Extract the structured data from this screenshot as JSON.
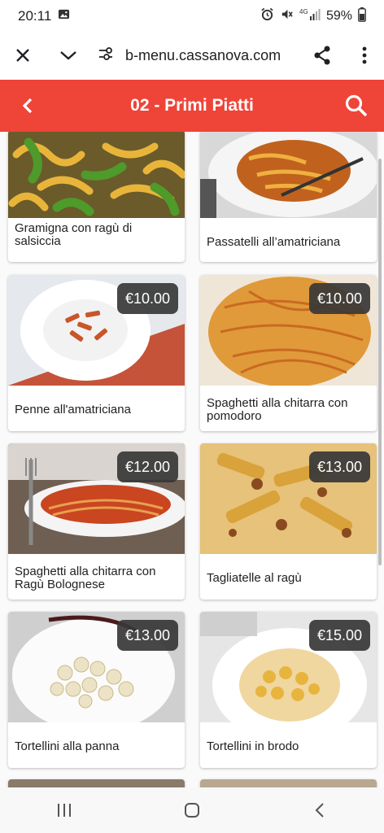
{
  "status_bar": {
    "time": "20:11",
    "battery": "59%",
    "signal_label": "4G",
    "icons": [
      "image-icon",
      "alarm-icon",
      "mute-icon",
      "signal-icon",
      "battery-icon"
    ]
  },
  "browser": {
    "url": "b-menu.cassanova.com",
    "icons": [
      "close-icon",
      "chevron-down-icon",
      "site-settings-icon",
      "share-icon",
      "more-vert-icon"
    ]
  },
  "header": {
    "title": "02 - Primi Piatti",
    "background": "#ef4438",
    "icons": [
      "back-arrow-icon",
      "search-icon"
    ]
  },
  "menu_items": [
    {
      "name": "Gramigna con ragù di salsiccia",
      "price": ""
    },
    {
      "name": "Passatelli all’amatriciana",
      "price": ""
    },
    {
      "name": "Penne all'amatriciana",
      "price": "€10.00"
    },
    {
      "name": "Spaghetti alla chitarra con pomodoro",
      "price": "€10.00"
    },
    {
      "name": "Spaghetti alla chitarra con Ragù Bolognese",
      "price": "€12.00"
    },
    {
      "name": "Tagliatelle al ragù",
      "price": "€13.00"
    },
    {
      "name": "Tortellini alla panna",
      "price": "€13.00"
    },
    {
      "name": "Tortellini in brodo",
      "price": "€15.00"
    }
  ],
  "nav_bar": {
    "icons": [
      "recents-icon",
      "home-icon",
      "back-icon"
    ]
  }
}
